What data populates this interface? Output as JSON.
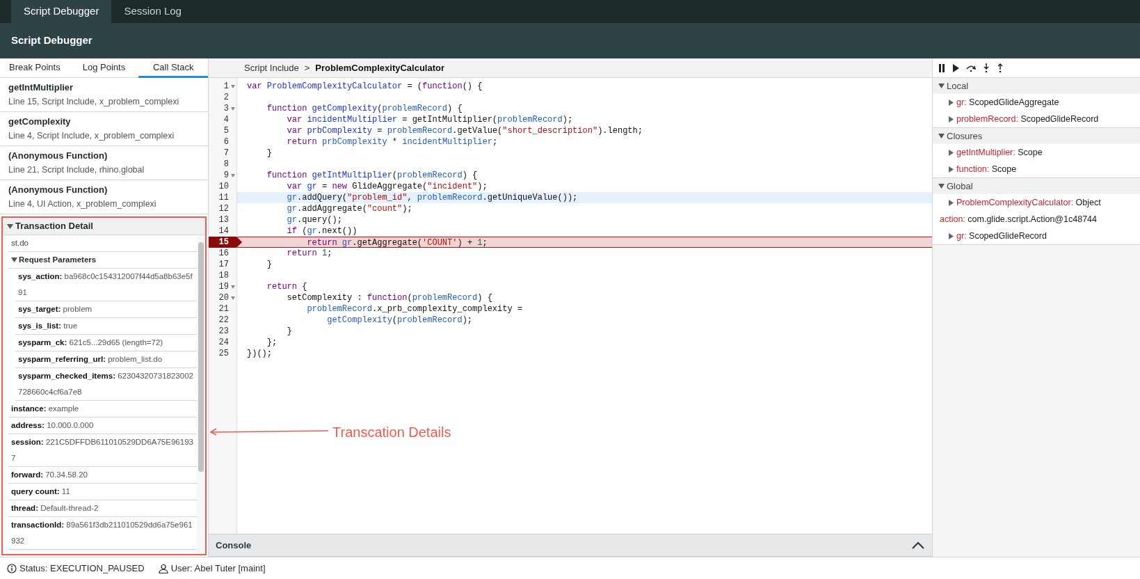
{
  "top_tabs": [
    {
      "label": "Script Debugger",
      "selected": true
    },
    {
      "label": "Session Log",
      "selected": false
    }
  ],
  "header": {
    "title": "Script Debugger"
  },
  "left_tabs": [
    {
      "label": "Break Points",
      "selected": false
    },
    {
      "label": "Log Points",
      "selected": false
    },
    {
      "label": "Call Stack",
      "selected": true
    }
  ],
  "call_stack": [
    {
      "name": "getIntMultiplier",
      "detail": "Line 15, Script Include, x_problem_complexi"
    },
    {
      "name": "getComplexity",
      "detail": "Line 4, Script Include, x_problem_complexi"
    },
    {
      "name": "(Anonymous Function)",
      "detail": "Line 21, Script Include, rhino.global"
    },
    {
      "name": "(Anonymous Function)",
      "detail": "Line 4, UI Action, x_problem_complexi"
    }
  ],
  "transaction_detail": {
    "title": "Transaction Detail",
    "expanded": true,
    "rows": [
      {
        "kind": "text",
        "text": "st.do"
      },
      {
        "kind": "group",
        "title": "Request Parameters",
        "expanded": true,
        "children": [
          {
            "key": "sys_action:",
            "value": "ba968c0c154312007f44d5a8b63e5f91"
          },
          {
            "key": "sys_target:",
            "value": "problem"
          },
          {
            "key": "sys_is_list:",
            "value": "true"
          },
          {
            "key": "sysparm_ck:",
            "value": "621c5...29d65 (length=72)"
          },
          {
            "key": "sysparm_referring_url:",
            "value": "problem_list.do"
          },
          {
            "key": "sysparm_checked_items:",
            "value": "62304320731823002728660c4cf6a7e8"
          }
        ]
      },
      {
        "kind": "pair",
        "key": "instance:",
        "value": "example"
      },
      {
        "kind": "pair",
        "key": "address:",
        "value": "10.000.0.000"
      },
      {
        "kind": "pair",
        "key": "session:",
        "value": "221C5DFFDB611010529DD6A75E961937"
      },
      {
        "kind": "pair",
        "key": "forward:",
        "value": "70.34.58.20"
      },
      {
        "kind": "pair",
        "key": "query count:",
        "value": "11"
      },
      {
        "kind": "pair",
        "key": "thread:",
        "value": "Default-thread-2"
      },
      {
        "kind": "pair",
        "key": "transactionId:",
        "value": "89a561f3db211010529dd6a75e961932"
      }
    ]
  },
  "breadcrumb": {
    "parent": "Script Include",
    "separator": ">",
    "current": "ProblemComplexityCalculator"
  },
  "code_lines": [
    {
      "number": "1",
      "foldable": true,
      "highlighted": false,
      "paused": false,
      "tokens": [
        {
          "kind": "keyword",
          "text": "var"
        },
        {
          "kind": "def",
          "text": " ProblemComplexityCalculator"
        },
        {
          "kind": "plain",
          "text": " = ("
        },
        {
          "kind": "keyword",
          "text": "function"
        },
        {
          "kind": "plain",
          "text": "() {"
        }
      ]
    },
    {
      "number": "2",
      "foldable": false,
      "highlighted": false,
      "paused": false
    },
    {
      "number": "3",
      "foldable": true,
      "highlighted": false,
      "paused": false,
      "tokens": [
        {
          "kind": "keyword",
          "text": "    function"
        },
        {
          "kind": "def",
          "text": " getComplexity"
        },
        {
          "kind": "plain",
          "text": "("
        },
        {
          "kind": "variable",
          "text": "problemRecord"
        },
        {
          "kind": "plain",
          "text": ") {"
        }
      ]
    },
    {
      "number": "4",
      "foldable": false,
      "highlighted": false,
      "paused": false,
      "tokens": [
        {
          "kind": "keyword",
          "text": "        var"
        },
        {
          "kind": "def",
          "text": " incidentMultiplier"
        },
        {
          "kind": "plain",
          "text": " = getIntMultiplier("
        },
        {
          "kind": "variable",
          "text": "problemRecord"
        },
        {
          "kind": "plain",
          "text": ");"
        }
      ]
    },
    {
      "number": "5",
      "foldable": false,
      "highlighted": false,
      "paused": false,
      "tokens": [
        {
          "kind": "keyword",
          "text": "        var"
        },
        {
          "kind": "def",
          "text": " prbComplexity"
        },
        {
          "kind": "plain",
          "text": " = "
        },
        {
          "kind": "variable",
          "text": "problemRecord"
        },
        {
          "kind": "plain",
          "text": ".getValue("
        },
        {
          "kind": "string",
          "text": "\"short_description\""
        },
        {
          "kind": "plain",
          "text": ").length;"
        }
      ]
    },
    {
      "number": "6",
      "foldable": false,
      "highlighted": false,
      "paused": false,
      "tokens": [
        {
          "kind": "keyword",
          "text": "        return"
        },
        {
          "kind": "variable",
          "text": " prbComplexity"
        },
        {
          "kind": "plain",
          "text": " * "
        },
        {
          "kind": "variable",
          "text": "incidentMultiplier"
        },
        {
          "kind": "plain",
          "text": ";"
        }
      ]
    },
    {
      "number": "7",
      "foldable": false,
      "highlighted": false,
      "paused": false,
      "tokens": [
        {
          "kind": "plain",
          "text": "    }"
        }
      ]
    },
    {
      "number": "8",
      "foldable": false,
      "highlighted": false,
      "paused": false
    },
    {
      "number": "9",
      "foldable": true,
      "highlighted": false,
      "paused": false,
      "tokens": [
        {
          "kind": "keyword",
          "text": "    function"
        },
        {
          "kind": "def",
          "text": " getIntMultiplier"
        },
        {
          "kind": "plain",
          "text": "("
        },
        {
          "kind": "variable",
          "text": "problemRecord"
        },
        {
          "kind": "plain",
          "text": ") {"
        }
      ]
    },
    {
      "number": "10",
      "foldable": false,
      "highlighted": false,
      "paused": false,
      "tokens": [
        {
          "kind": "keyword",
          "text": "        var"
        },
        {
          "kind": "def",
          "text": " gr"
        },
        {
          "kind": "plain",
          "text": " = "
        },
        {
          "kind": "keyword",
          "text": "new"
        },
        {
          "kind": "plain",
          "text": " GlideAggregate("
        },
        {
          "kind": "string",
          "text": "\"incident\""
        },
        {
          "kind": "plain",
          "text": ");"
        }
      ]
    },
    {
      "number": "11",
      "foldable": false,
      "highlighted": true,
      "paused": false,
      "tokens": [
        {
          "kind": "variable",
          "text": "        gr"
        },
        {
          "kind": "plain",
          "text": ".addQuery("
        },
        {
          "kind": "string",
          "text": "\"problem_id\""
        },
        {
          "kind": "plain",
          "text": ", "
        },
        {
          "kind": "variable",
          "text": "problemRecord"
        },
        {
          "kind": "plain",
          "text": ".getUniqueValue());"
        }
      ]
    },
    {
      "number": "12",
      "foldable": false,
      "highlighted": false,
      "paused": false,
      "tokens": [
        {
          "kind": "variable",
          "text": "        gr"
        },
        {
          "kind": "plain",
          "text": ".addAggregate("
        },
        {
          "kind": "string",
          "text": "\"count\""
        },
        {
          "kind": "plain",
          "text": ");"
        }
      ]
    },
    {
      "number": "13",
      "foldable": false,
      "highlighted": false,
      "paused": false,
      "tokens": [
        {
          "kind": "variable",
          "text": "        gr"
        },
        {
          "kind": "plain",
          "text": ".query();"
        }
      ]
    },
    {
      "number": "14",
      "foldable": false,
      "highlighted": false,
      "paused": false,
      "tokens": [
        {
          "kind": "keyword",
          "text": "        if"
        },
        {
          "kind": "plain",
          "text": " ("
        },
        {
          "kind": "variable",
          "text": "gr"
        },
        {
          "kind": "plain",
          "text": ".next())"
        }
      ]
    },
    {
      "number": "15",
      "foldable": false,
      "highlighted": false,
      "paused": true,
      "tokens": [
        {
          "kind": "keyword",
          "text": "            return"
        },
        {
          "kind": "variable",
          "text": " gr"
        },
        {
          "kind": "plain",
          "text": ".getAggregate("
        },
        {
          "kind": "string",
          "text": "'COUNT'"
        },
        {
          "kind": "plain",
          "text": ") + "
        },
        {
          "kind": "number",
          "text": "1"
        },
        {
          "kind": "plain",
          "text": ";"
        }
      ]
    },
    {
      "number": "16",
      "foldable": false,
      "highlighted": false,
      "paused": false,
      "tokens": [
        {
          "kind": "keyword",
          "text": "        return"
        },
        {
          "kind": "number",
          "text": " 1"
        },
        {
          "kind": "plain",
          "text": ";"
        }
      ]
    },
    {
      "number": "17",
      "foldable": false,
      "highlighted": false,
      "paused": false,
      "tokens": [
        {
          "kind": "plain",
          "text": "    }"
        }
      ]
    },
    {
      "number": "18",
      "foldable": false,
      "highlighted": false,
      "paused": false
    },
    {
      "number": "19",
      "foldable": true,
      "highlighted": false,
      "paused": false,
      "tokens": [
        {
          "kind": "keyword",
          "text": "    return"
        },
        {
          "kind": "plain",
          "text": " {"
        }
      ]
    },
    {
      "number": "20",
      "foldable": true,
      "highlighted": false,
      "paused": false,
      "tokens": [
        {
          "kind": "plain",
          "text": "        setComplexity : "
        },
        {
          "kind": "keyword",
          "text": "function"
        },
        {
          "kind": "plain",
          "text": "("
        },
        {
          "kind": "variable",
          "text": "problemRecord"
        },
        {
          "kind": "plain",
          "text": ") {"
        }
      ]
    },
    {
      "number": "21",
      "foldable": false,
      "highlighted": false,
      "paused": false,
      "tokens": [
        {
          "kind": "variable",
          "text": "            problemRecord"
        },
        {
          "kind": "plain",
          "text": ".x_prb_complexity_complexity ="
        }
      ]
    },
    {
      "number": "22",
      "foldable": false,
      "highlighted": false,
      "paused": false,
      "tokens": [
        {
          "kind": "variable",
          "text": "                getComplexity"
        },
        {
          "kind": "plain",
          "text": "("
        },
        {
          "kind": "variable",
          "text": "problemRecord"
        },
        {
          "kind": "plain",
          "text": ");"
        }
      ]
    },
    {
      "number": "23",
      "foldable": false,
      "highlighted": false,
      "paused": false,
      "tokens": [
        {
          "kind": "plain",
          "text": "        }"
        }
      ]
    },
    {
      "number": "24",
      "foldable": false,
      "highlighted": false,
      "paused": false,
      "tokens": [
        {
          "kind": "plain",
          "text": "    };"
        }
      ]
    },
    {
      "number": "25",
      "foldable": false,
      "highlighted": false,
      "paused": false,
      "tokens": [
        {
          "kind": "plain",
          "text": "})();"
        }
      ]
    }
  ],
  "console": {
    "label": "Console",
    "expanded": false
  },
  "scopes": [
    {
      "title": "Local",
      "expanded": true,
      "items": [
        {
          "name": "gr:",
          "value": "ScopedGlideAggregate",
          "expandable": true
        },
        {
          "name": "problemRecord:",
          "value": "ScopedGlideRecord",
          "expandable": true
        }
      ]
    },
    {
      "title": "Closures",
      "expanded": true,
      "items": [
        {
          "name": "getIntMultiplier:",
          "value": "Scope",
          "expandable": true
        },
        {
          "name": "function:",
          "value": "Scope",
          "expandable": true
        }
      ]
    },
    {
      "title": "Global",
      "expanded": true,
      "items": [
        {
          "name": "ProblemComplexityCalculator:",
          "value": "Object",
          "expandable": true
        },
        {
          "name": "action:",
          "value": "com.glide.script.Action@1c48744",
          "expandable": false
        },
        {
          "name": "gr:",
          "value": "ScopedGlideRecord",
          "expandable": true
        }
      ]
    }
  ],
  "status_bar": {
    "status": "Status: EXECUTION_PAUSED",
    "user": "User: Abel Tuter [maint]"
  },
  "annotation": {
    "label": "Transcation Details"
  }
}
